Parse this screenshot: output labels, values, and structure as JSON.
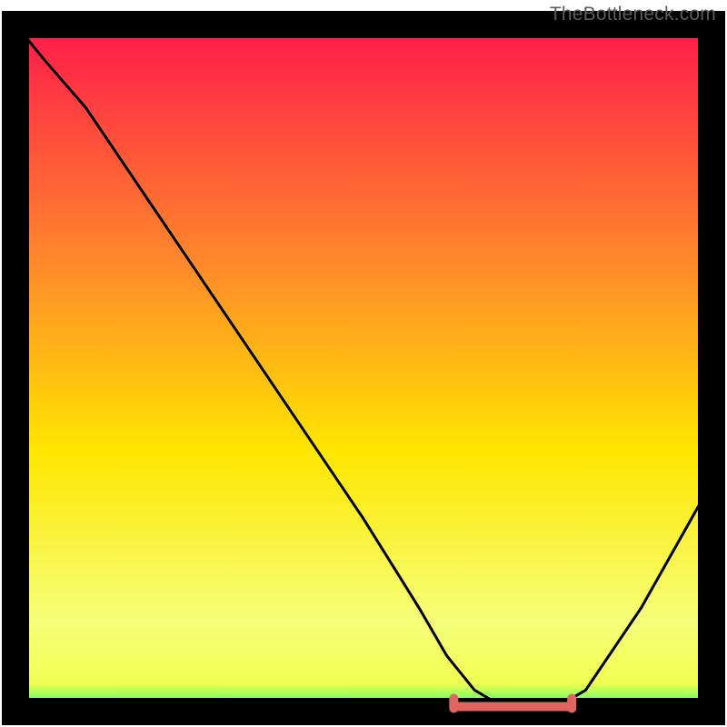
{
  "watermark": "TheBottleneck.com",
  "colors": {
    "frame": "#000000",
    "curve": "#000000",
    "marker": "#e0645f",
    "grad_top": "#ff1a4b",
    "grad_mid1": "#ff8a2a",
    "grad_mid2": "#ffe600",
    "grad_low": "#f6ff7a",
    "grad_bottom_yellow": "#f0ff52",
    "grad_green": "#2bff6e"
  },
  "chart_data": {
    "type": "line",
    "title": "",
    "xlabel": "",
    "ylabel": "",
    "xlim": [
      0,
      100
    ],
    "ylim": [
      0,
      100
    ],
    "series": [
      {
        "name": "bottleneck-curve",
        "x": [
          0,
          4,
          10,
          20,
          30,
          40,
          50,
          58,
          62,
          66,
          70,
          74,
          78,
          82,
          90,
          100
        ],
        "y": [
          100,
          95,
          88,
          73,
          58,
          43,
          28,
          15,
          8,
          3,
          0.6,
          0.6,
          0.6,
          3,
          15,
          33
        ]
      }
    ],
    "flat_min_segment": {
      "x_start": 63,
      "x_end": 80,
      "y": 0.6
    }
  }
}
